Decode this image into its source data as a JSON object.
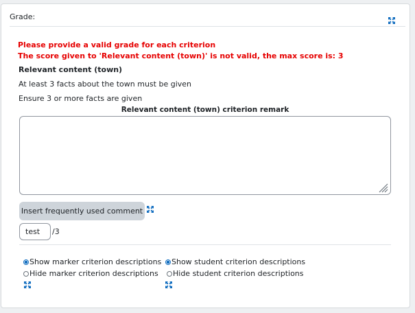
{
  "card": {
    "header": "Grade:"
  },
  "errors": [
    "Please provide a valid grade for each criterion",
    "The score given to 'Relevant content (town)' is not valid, the max score is: 3"
  ],
  "criterion": {
    "title": "Relevant content (town)",
    "marker_description": "At least 3 facts about the town must be given",
    "student_description": "Ensure 3 or more facts are given",
    "remark_label": "Relevant content (town) criterion remark",
    "remark_value": "",
    "frequent_comment_button": "Insert frequently used comment",
    "score_value": "test",
    "score_max": "/3"
  },
  "options": {
    "marker": {
      "show": "Show marker criterion descriptions",
      "hide": "Hide marker criterion descriptions",
      "selected": "show"
    },
    "student": {
      "show": "Show student criterion descriptions",
      "hide": "Hide student criterion descriptions",
      "selected": "show"
    }
  },
  "colors": {
    "error": "#e60000",
    "icon": "#0f6cbf",
    "button": "#ced4da"
  },
  "icons": [
    "expand-icon",
    "resize-grip-icon"
  ]
}
